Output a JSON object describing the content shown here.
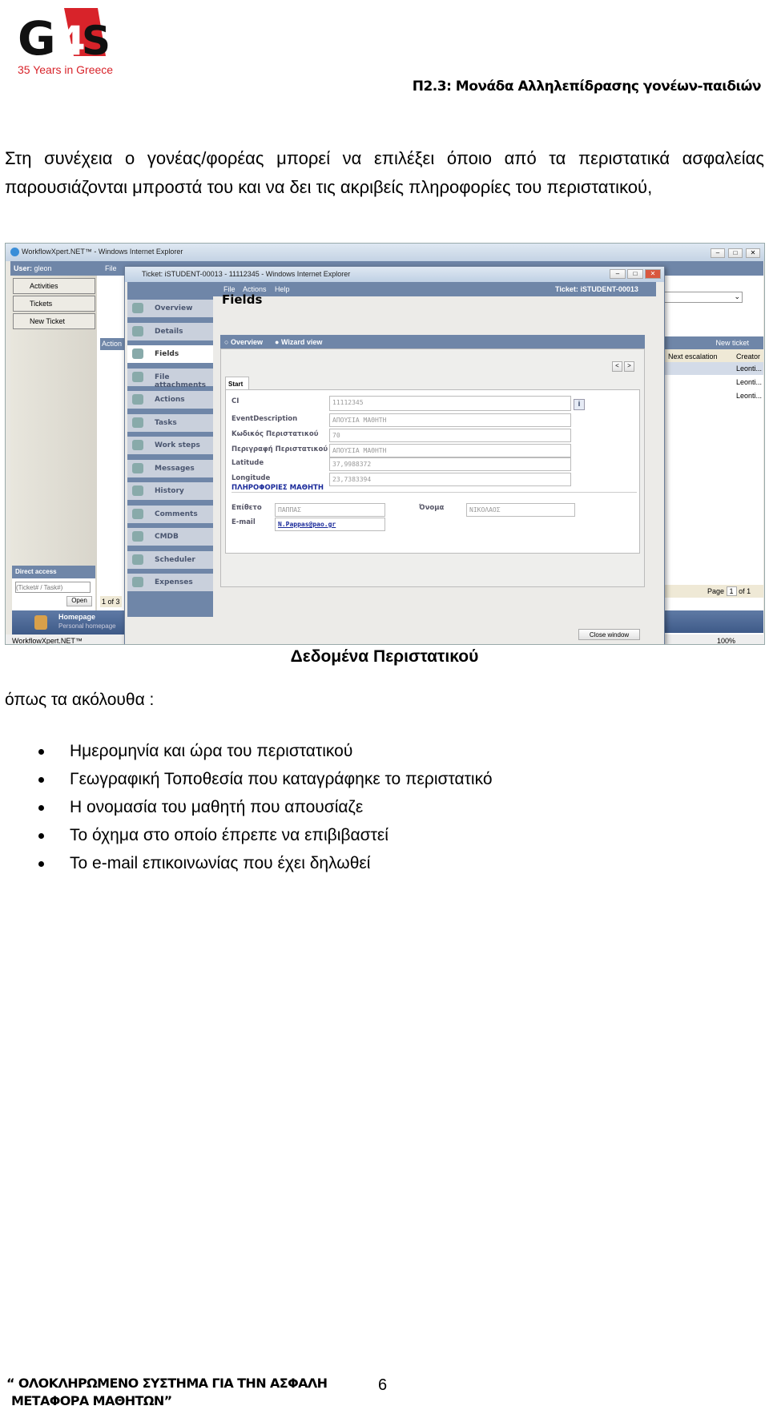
{
  "header": {
    "logo_text": "G4S",
    "logo_sub": "35 Years in Greece",
    "title": "Π2.3: Μονάδα Αλληλεπίδρασης γονέων-παιδιών"
  },
  "intro_paragraph": "Στη συνέχεια ο γονέας/φορέας μπορεί να επιλέξει όποιο από τα περιστατικά ασφαλείας παρουσιάζονται μπροστά του και να δει τις ακριβείς πληροφορίες του περιστατικού,",
  "screenshot": {
    "outer_title": "WorkflowXpert.NET™ - Windows Internet Explorer",
    "user_label": "User:",
    "user_name": "gleon",
    "outer_menu_file": "File",
    "left_nav": [
      "Activities",
      "Tickets",
      "New Ticket"
    ],
    "action_label": "Action",
    "direct_access": {
      "title": "Direct access",
      "placeholder": "(Ticket# / Task#)",
      "open": "Open"
    },
    "list_pager": "1 of 3",
    "homepage": {
      "title": "Homepage",
      "sub": "Personal homepage"
    },
    "status_bar": "WorkflowXpert.NET™",
    "zoom": "100%",
    "right_pane": {
      "new_ticket": "New ticket",
      "columns": [
        "Next escalation",
        "Creator"
      ],
      "creators": [
        "Leonti...",
        "Leonti...",
        "Leonti..."
      ],
      "page_label": "Page",
      "page_value": "1",
      "page_of": "of 1"
    },
    "popup": {
      "title": "Ticket: iSTUDENT-00013 - 11112345 - Windows Internet Explorer",
      "menu": [
        "File",
        "Actions",
        "Help"
      ],
      "ticket_label": "Ticket: iSTUDENT-00013",
      "sidebar": [
        "Overview",
        "Details",
        "Fields",
        "File attachments",
        "Actions",
        "Tasks",
        "Work steps",
        "Messages",
        "History",
        "Comments",
        "CMDB",
        "Scheduler",
        "Expenses"
      ],
      "active_item": "Fields",
      "page_title": "Fields",
      "view_options": [
        "Overview",
        "Wizard view"
      ],
      "selected_view": "Wizard view",
      "tab": "Start",
      "fields": [
        {
          "label": "CI",
          "value": "11112345"
        },
        {
          "label": "EventDescription",
          "value": "ΑΠΟΥΣΙΑ ΜΑΘΗΤΗ"
        },
        {
          "label": "Κωδικός Περιστατικού",
          "value": "70"
        },
        {
          "label": "Περιγραφή Περιστατικού",
          "value": "ΑΠΟΥΣΙΑ ΜΑΘΗΤΗ"
        },
        {
          "label": "Latitude",
          "value": "37,9988372"
        },
        {
          "label": "Longitude",
          "value": "23,7383394"
        }
      ],
      "section_title": "ΠΛΗΡΟΦΟΡΙΕΣ ΜΑΘΗΤΗ",
      "student": {
        "surname_label": "Επίθετο",
        "surname": "ΠΑΠΠΑΣ",
        "name_label": "Όνομα",
        "name": "ΝΙΚΟΛΑΟΣ",
        "email_label": "E-mail",
        "email": "N.Pappas@pao.gr"
      },
      "close_button": "Close window"
    }
  },
  "caption": "Δεδομένα Περιστατικού",
  "list_intro": "όπως τα ακόλουθα :",
  "bullets": [
    "Ημερομηνία και ώρα του περιστατικού",
    "Γεωγραφική Τοποθεσία που καταγράφηκε το περιστατικό",
    "Η ονομασία του μαθητή που απουσίαζε",
    "Το όχημα στο οποίο έπρεπε να επιβιβαστεί",
    "Το e-mail επικοινωνίας που έχει δηλωθεί"
  ],
  "footer": {
    "line1": "“ ΟΛΟΚΛΗΡΩΜΕΝΟ ΣΥΣΤΗΜΑ ΓΙΑ ΤΗΝ ΑΣΦΑΛΗ",
    "line2": "ΜΕΤΑΦΟΡΑ ΜΑΘΗΤΩΝ”",
    "page": "6"
  },
  "colors": {
    "logo_red": "#d8232a",
    "bar_blue": "#6f86a8",
    "link_blue": "#1a2a9a"
  }
}
